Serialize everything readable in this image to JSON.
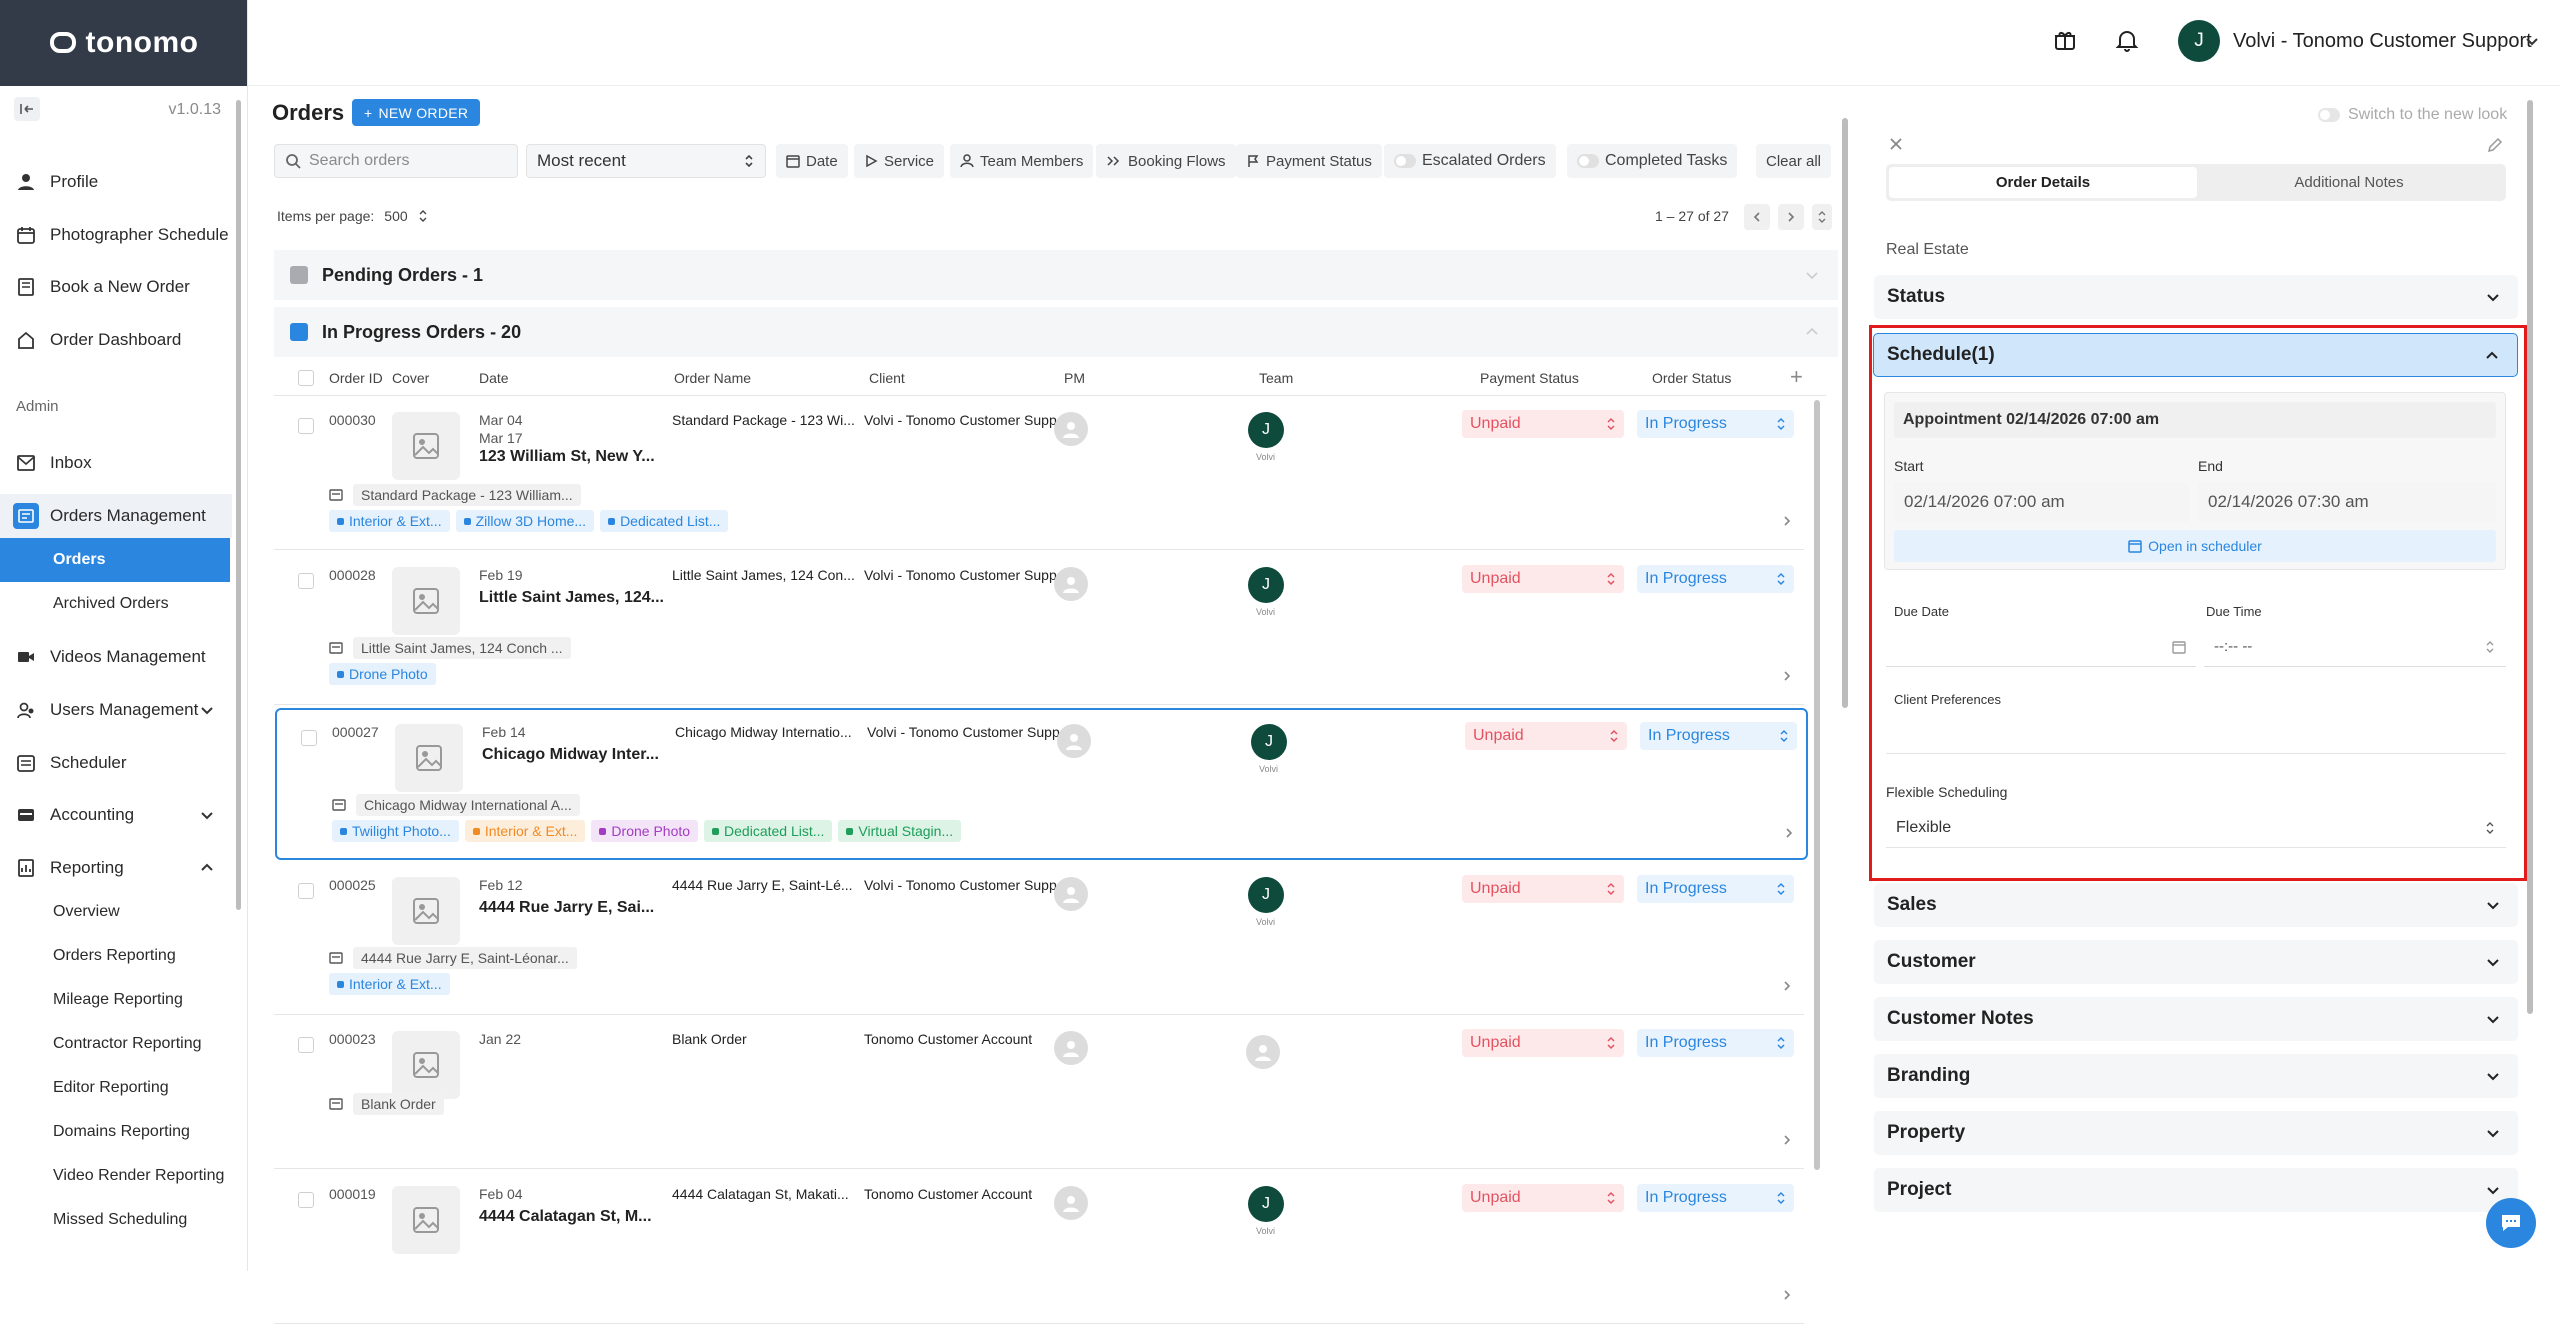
{
  "app": {
    "logo_text": "tonomo",
    "version": "v1.0.13"
  },
  "user": {
    "initial": "J",
    "name": "Volvi - Tonomo Customer Support"
  },
  "sidebar": {
    "items": [
      {
        "label": "Profile"
      },
      {
        "label": "Photographer Schedule"
      },
      {
        "label": "Book a New Order"
      },
      {
        "label": "Order Dashboard"
      }
    ],
    "admin_label": "Admin",
    "admin_items": [
      {
        "label": "Inbox"
      },
      {
        "label": "Orders Management"
      },
      {
        "label": "Orders"
      },
      {
        "label": "Archived Orders"
      },
      {
        "label": "Videos Management"
      },
      {
        "label": "Users Management"
      },
      {
        "label": "Scheduler"
      },
      {
        "label": "Accounting"
      },
      {
        "label": "Reporting"
      },
      {
        "label": "Overview"
      },
      {
        "label": "Orders Reporting"
      },
      {
        "label": "Mileage Reporting"
      },
      {
        "label": "Contractor Reporting"
      },
      {
        "label": "Editor Reporting"
      },
      {
        "label": "Domains Reporting"
      },
      {
        "label": "Video Render Reporting"
      },
      {
        "label": "Missed Scheduling"
      }
    ]
  },
  "orders": {
    "title": "Orders",
    "new_order": "NEW ORDER",
    "search_placeholder": "Search orders",
    "sort": "Most recent",
    "filters": [
      "Date",
      "Service",
      "Team Members",
      "Booking Flows",
      "Payment Status"
    ],
    "toggles": [
      "Escalated Orders",
      "Completed Tasks"
    ],
    "clear_all": "Clear all",
    "items_per_page_label": "Items per page:",
    "items_per_page": "500",
    "range": "1 – 27 of 27",
    "groups": [
      {
        "label": "Pending Orders - 1",
        "color": "#a9abb0"
      },
      {
        "label": "In Progress Orders - 20",
        "color": "#2a86de"
      }
    ],
    "columns": [
      "Order ID",
      "Cover",
      "Date",
      "Order Name",
      "Client",
      "PM",
      "Team",
      "Payment Status",
      "Order Status"
    ],
    "rows": [
      {
        "id": "000030",
        "date": "Mar 04",
        "date2": "Mar 17",
        "title": "123 William St, New Y...",
        "name": "Standard Package - 123 Wi...",
        "client": "Volvi - Tonomo Customer Support",
        "team": "J",
        "team_label": "Volvi",
        "payment": "Unpaid",
        "status": "In Progress",
        "sub": "Standard Package - 123 William...",
        "tags": [
          {
            "label": "Interior & Ext...",
            "color": "#2a86de",
            "bg": "#e5f1fc"
          },
          {
            "label": "Zillow 3D Home...",
            "color": "#2a86de",
            "bg": "#e5f1fc"
          },
          {
            "label": "Dedicated List...",
            "color": "#2a86de",
            "bg": "#e5f1fc"
          }
        ]
      },
      {
        "id": "000028",
        "date": "Feb 19",
        "date2": "",
        "title": "Little Saint James, 124...",
        "name": "Little Saint James, 124 Con...",
        "client": "Volvi - Tonomo Customer Support",
        "team": "J",
        "team_label": "Volvi",
        "payment": "Unpaid",
        "status": "In Progress",
        "sub": "Little Saint James, 124 Conch ...",
        "tags": [
          {
            "label": "Drone Photo",
            "color": "#2a86de",
            "bg": "#e5f1fc"
          }
        ]
      },
      {
        "id": "000027",
        "date": "Feb 14",
        "date2": "",
        "title": "Chicago Midway Inter...",
        "name": "Chicago Midway Internatio...",
        "client": "Volvi - Tonomo Customer Support",
        "team": "J",
        "team_label": "Volvi",
        "payment": "Unpaid",
        "status": "In Progress",
        "sub": "Chicago Midway International A...",
        "tags": [
          {
            "label": "Twilight Photo...",
            "color": "#2a86de",
            "bg": "#e5f1fc"
          },
          {
            "label": "Interior & Ext...",
            "color": "#f08a24",
            "bg": "#fdeedc"
          },
          {
            "label": "Drone Photo",
            "color": "#a43bc4",
            "bg": "#f4e4f8"
          },
          {
            "label": "Dedicated List...",
            "color": "#1e9e5a",
            "bg": "#ddf3e6"
          },
          {
            "label": "Virtual Stagin...",
            "color": "#1e9e5a",
            "bg": "#ddf3e6"
          }
        ]
      },
      {
        "id": "000025",
        "date": "Feb 12",
        "date2": "",
        "title": "4444 Rue Jarry E, Sai...",
        "name": "4444 Rue Jarry E, Saint-Lé...",
        "client": "Volvi - Tonomo Customer Support",
        "team": "J",
        "team_label": "Volvi",
        "payment": "Unpaid",
        "status": "In Progress",
        "sub": "4444 Rue Jarry E, Saint-Léonar...",
        "tags": [
          {
            "label": "Interior & Ext...",
            "color": "#2a86de",
            "bg": "#e5f1fc"
          }
        ]
      },
      {
        "id": "000023",
        "date": "Jan 22",
        "date2": "",
        "title": "",
        "name": "Blank Order",
        "client": "Tonomo Customer Account",
        "team": "",
        "team_label": "",
        "payment": "Unpaid",
        "status": "In Progress",
        "sub": "Blank Order",
        "tags": []
      },
      {
        "id": "000019",
        "date": "Feb 04",
        "date2": "",
        "title": "4444 Calatagan St, M...",
        "name": "4444 Calatagan St, Makati...",
        "client": "Tonomo Customer Account",
        "team": "J",
        "team_label": "Volvi",
        "payment": "Unpaid",
        "status": "In Progress",
        "sub": "",
        "tags": []
      }
    ]
  },
  "panel": {
    "switch_label": "Switch to the new look",
    "tabs": [
      "Order Details",
      "Additional Notes"
    ],
    "category": "Real Estate",
    "status_label": "Status",
    "schedule_label": "Schedule(1)",
    "appointment_title": "Appointment 02/14/2026 07:00 am",
    "start_label": "Start",
    "end_label": "End",
    "start_value": "02/14/2026 07:00 am",
    "end_value": "02/14/2026 07:30 am",
    "open_scheduler": "Open in scheduler",
    "due_date_label": "Due Date",
    "due_time_label": "Due Time",
    "due_time_value": "--:-- --",
    "client_pref_label": "Client Preferences",
    "flex_label": "Flexible Scheduling",
    "flex_value": "Flexible",
    "sections": [
      "Sales",
      "Customer",
      "Customer Notes",
      "Branding",
      "Property",
      "Project"
    ]
  }
}
